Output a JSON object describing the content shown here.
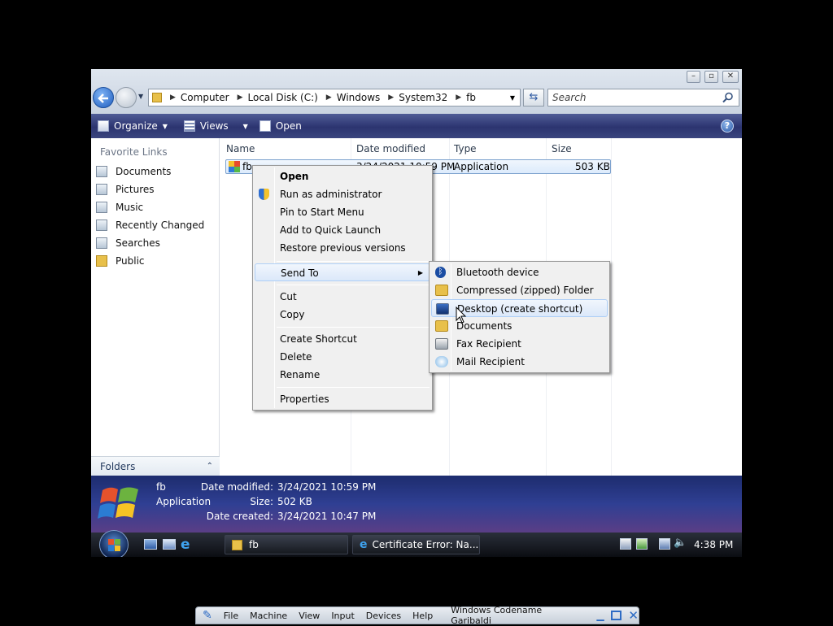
{
  "window": {
    "address": [
      "Computer",
      "Local Disk (C:)",
      "Windows",
      "System32",
      "fb"
    ],
    "search_placeholder": "Search",
    "caption": {
      "minimize": "–",
      "maximize": "▫",
      "close": "✕"
    }
  },
  "toolbar": {
    "organize": "Organize",
    "views": "Views",
    "open": "Open",
    "help": "?"
  },
  "nav": {
    "header": "Favorite Links",
    "items": [
      {
        "label": "Documents",
        "icon": "documents-icon"
      },
      {
        "label": "Pictures",
        "icon": "pictures-icon"
      },
      {
        "label": "Music",
        "icon": "music-icon"
      },
      {
        "label": "Recently Changed",
        "icon": "recently-changed-icon"
      },
      {
        "label": "Searches",
        "icon": "searches-icon"
      },
      {
        "label": "Public",
        "icon": "folder-icon"
      }
    ],
    "folders": "Folders"
  },
  "columns": {
    "name": "Name",
    "date": "Date modified",
    "type": "Type",
    "size": "Size"
  },
  "file": {
    "name": "fb",
    "date": "3/24/2021 10:59 PM",
    "type": "Application",
    "size": "503 KB"
  },
  "context_menu": {
    "open": "Open",
    "run_admin": "Run as administrator",
    "pin_start": "Pin to Start Menu",
    "quick_launch": "Add to Quick Launch",
    "restore": "Restore previous versions",
    "send_to": "Send To",
    "cut": "Cut",
    "copy": "Copy",
    "create_shortcut": "Create Shortcut",
    "delete": "Delete",
    "rename": "Rename",
    "properties": "Properties"
  },
  "send_to_menu": {
    "bluetooth": "Bluetooth device",
    "compressed": "Compressed (zipped) Folder",
    "desktop": "Desktop (create shortcut)",
    "documents": "Documents",
    "fax": "Fax Recipient",
    "mail": "Mail Recipient"
  },
  "details": {
    "name": "fb",
    "type": "Application",
    "date_modified_label": "Date modified:",
    "date_modified": "3/24/2021 10:59 PM",
    "size_label": "Size:",
    "size": "502 KB",
    "date_created_label": "Date created:",
    "date_created": "3/24/2021 10:47 PM"
  },
  "taskbar": {
    "task1": "fb",
    "task2": "Certificate Error: Na...",
    "clock": "4:38 PM"
  },
  "vbox": {
    "file": "File",
    "machine": "Machine",
    "view": "View",
    "input": "Input",
    "devices": "Devices",
    "help": "Help",
    "title": "Windows Codename Garibaldi"
  },
  "colors": {
    "toolbar": "#2c3470",
    "details": "#2f3f93",
    "highlight": "#dbe8f9"
  }
}
